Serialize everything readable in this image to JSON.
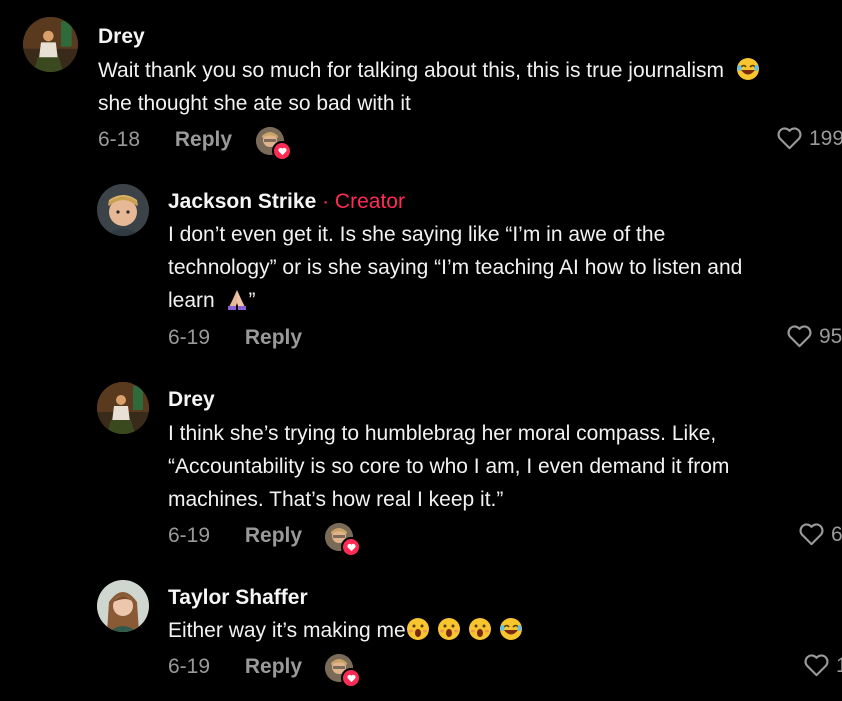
{
  "comments": [
    {
      "author": "Drey",
      "lines": [
        "Wait thank you so much for talking about this, this is true journalism",
        "she thought she ate so bad with it"
      ],
      "emoji": "laughing-emoji",
      "date": "6-18",
      "reply_label": "Reply",
      "likes": "199"
    },
    {
      "author": "Jackson Strike",
      "creator_tag": " · Creator",
      "lines": [
        "I don’t even get it. Is she saying like “I’m in awe of the",
        "technology” or is she saying “I’m teaching AI how to listen and",
        "learn",
        "”"
      ],
      "emoji": "praying-hands-emoji",
      "date": "6-19",
      "reply_label": "Reply",
      "likes": "95"
    },
    {
      "author": "Drey",
      "lines": [
        "I think she’s trying to humblebrag her moral compass. Like,",
        "“Accountability is so core to who I am, I even demand it from",
        "machines. That’s how real I keep it.”"
      ],
      "date": "6-19",
      "reply_label": "Reply",
      "likes": "6"
    },
    {
      "author": "Taylor Shaffer",
      "lines": [
        "Either way it’s making me"
      ],
      "emojis": [
        "surprised-emoji",
        "surprised-emoji",
        "surprised-emoji",
        "laughing-emoji"
      ],
      "date": "6-19",
      "reply_label": "Reply",
      "likes": "1"
    }
  ],
  "colors": {
    "background": "#000000",
    "text": "#f2f2f2",
    "muted": "#9a9a9a",
    "creator_accent": "#fe2c55",
    "like_badge": "#fe2c55"
  }
}
